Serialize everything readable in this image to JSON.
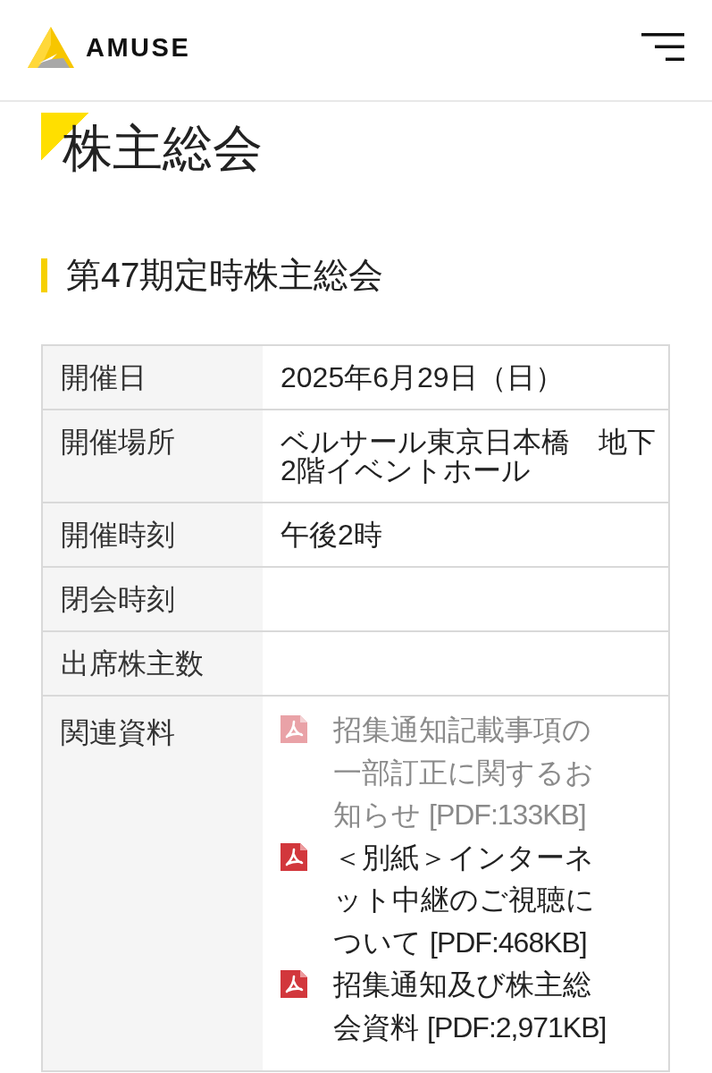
{
  "header": {
    "logo": {
      "text": "AMUSE"
    }
  },
  "page_title": "株主総会",
  "section": {
    "title": "第47期定時株主総会"
  },
  "table": {
    "rows": [
      {
        "kind": "text",
        "label": "開催日",
        "value": "2025年6月29日（日）"
      },
      {
        "kind": "text",
        "label": "開催場所",
        "value": "ベルサール東京日本橋　地下2階イベントホール"
      },
      {
        "kind": "text",
        "label": "開催時刻",
        "value": "午後2時"
      },
      {
        "kind": "text",
        "label": "閉会時刻"
      },
      {
        "kind": "text",
        "label": "出席株主数"
      },
      {
        "kind": "documents",
        "label": "関連資料",
        "documents": [
          {
            "title": "招集通知記載事項の一部訂正に関するお知らせ",
            "size": "[PDF:133KB]",
            "visited": true
          },
          {
            "title": "＜別紙＞インターネット中継のご視聴について",
            "size": "[PDF:468KB]",
            "visited": false
          },
          {
            "title": "招集通知及び株主総会資料",
            "size": "[PDF:2,971KB]",
            "visited": false
          }
        ]
      }
    ]
  }
}
